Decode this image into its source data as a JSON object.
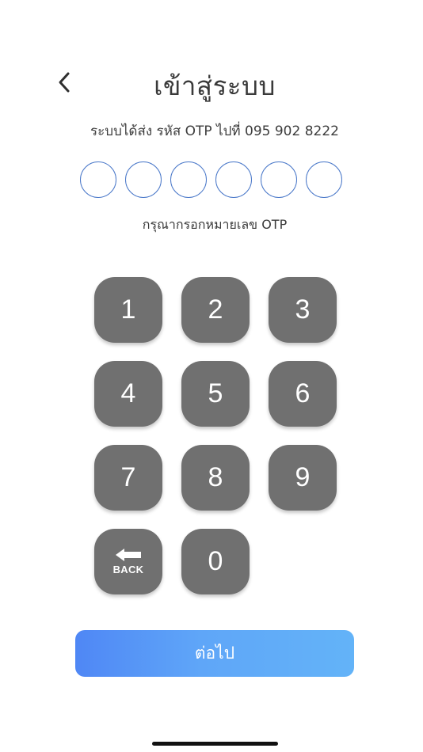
{
  "header": {
    "title": "เข้าสู่ระบบ",
    "back_icon": "chevron-left-icon"
  },
  "otp": {
    "message": "ระบบได้ส่ง รหัส OTP ไปที่ 095 902 8222",
    "digits": [
      "",
      "",
      "",
      "",
      "",
      ""
    ],
    "hint": "กรุณากรอกหมายเลข OTP",
    "circle_color": "#4a78c9"
  },
  "keypad": {
    "keys": [
      "1",
      "2",
      "3",
      "4",
      "5",
      "6",
      "7",
      "8",
      "9"
    ],
    "back_label": "BACK",
    "back_icon": "arrow-left-icon",
    "zero": "0",
    "key_color": "#707070"
  },
  "actions": {
    "next_label": "ต่อไป",
    "gradient_start": "#4f87f5",
    "gradient_end": "#63b3f8"
  }
}
